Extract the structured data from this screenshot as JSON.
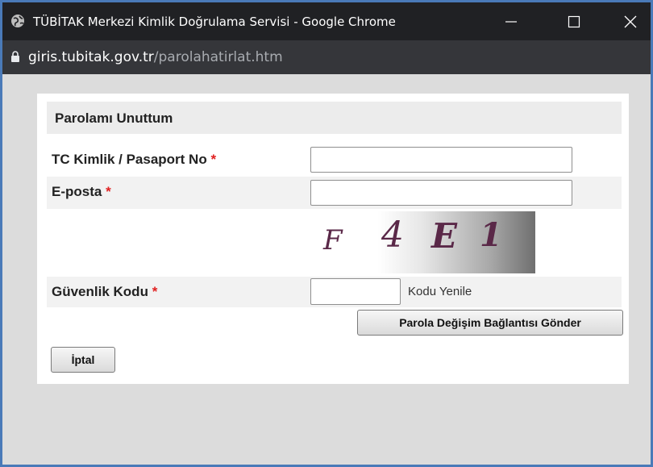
{
  "window": {
    "title": "TÜBİTAK Merkezi Kimlik Doğrulama Servisi - Google Chrome"
  },
  "address": {
    "host": "giris.tubitak.gov.tr",
    "path": "/parolahatirlat.htm"
  },
  "form": {
    "heading": "Parolamı Unuttum",
    "tc_label": "TC Kimlik / Pasaport No",
    "tc_value": "",
    "email_label": "E-posta",
    "email_value": "",
    "required_mark": "*",
    "captcha_text": [
      "F",
      "4",
      "E",
      "1"
    ],
    "security_label": "Güvenlik Kodu",
    "security_value": "",
    "refresh_label": "Kodu Yenile",
    "submit_label": "Parola Değişim Bağlantısı Gönder",
    "cancel_label": "İptal"
  },
  "colors": {
    "accent_border": "#4a7ab8",
    "required": "#e02020",
    "titlebar": "#202124"
  },
  "icons": {
    "tab": "globe-icon",
    "secure": "lock-icon",
    "minimize": "minimize-icon",
    "maximize": "maximize-icon",
    "close": "close-icon"
  }
}
